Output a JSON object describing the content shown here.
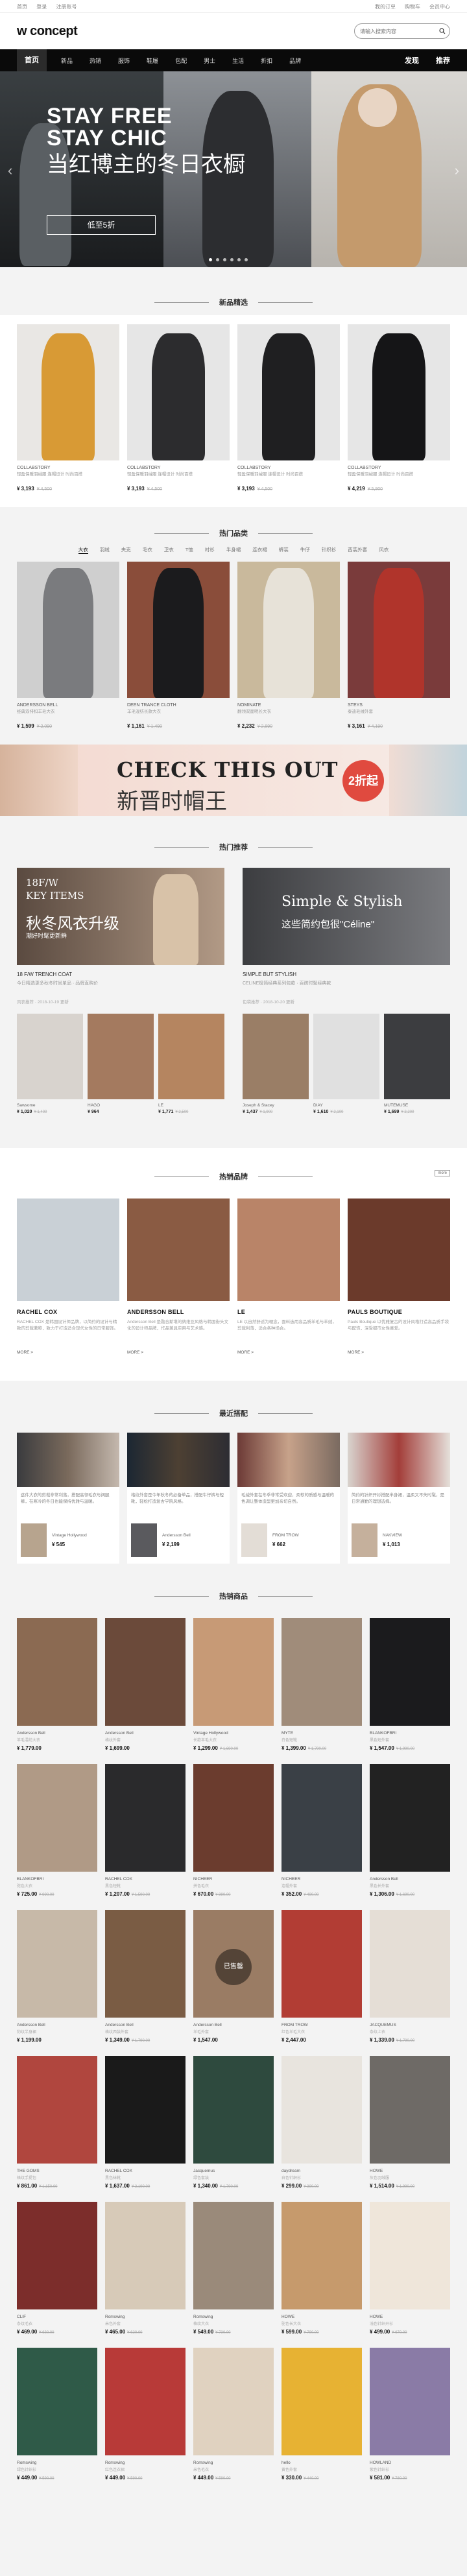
{
  "topbar": {
    "left": [
      "首页",
      "登录",
      "注册账号"
    ],
    "right": [
      "我的订单",
      "购物车",
      "会员中心"
    ]
  },
  "header": {
    "logo": "w concept",
    "search_placeholder": "请输入搜索内容"
  },
  "nav": {
    "items": [
      "首页",
      "新品",
      "热销",
      "服饰",
      "鞋履",
      "包配",
      "男士",
      "生活",
      "折扣",
      "品牌",
      "发现",
      "推荐"
    ]
  },
  "hero": {
    "headline1": "STAY FREE",
    "headline2": "STAY CHIC",
    "cn": "当红博主的冬日衣橱",
    "cta": "低至5折"
  },
  "sections": {
    "new": "新品精选",
    "hot_category": "热门品类",
    "hot_recommend": "热门推荐",
    "hot_brand": "热销品牌",
    "blog": "最近搭配",
    "hot_products": "热销商品"
  },
  "new_products": [
    {
      "brand": "COLLABSTORY",
      "desc": "轻盈保暖羽绒服 连帽设计 时尚百搭",
      "price": "¥ 3,193",
      "old": "¥ 4,500"
    },
    {
      "brand": "COLLABSTORY",
      "desc": "轻盈保暖羽绒服 连帽设计 时尚百搭",
      "price": "¥ 3,193",
      "old": "¥ 4,500"
    },
    {
      "brand": "COLLABSTORY",
      "desc": "轻盈保暖羽绒服 连帽设计 时尚百搭",
      "price": "¥ 3,193",
      "old": "¥ 4,500"
    },
    {
      "brand": "COLLABSTORY",
      "desc": "轻盈保暖羽绒服 连帽设计 时尚百搭",
      "price": "¥ 4,219",
      "old": "¥ 5,900"
    }
  ],
  "category_tabs": [
    "大衣",
    "羽绒",
    "夹克",
    "毛衣",
    "卫衣",
    "T恤",
    "衬衫",
    "半身裙",
    "连衣裙",
    "裤装",
    "牛仔",
    "针织衫",
    "西装外套",
    "风衣",
    "半裙"
  ],
  "category_products": [
    {
      "brand": "Andersson Bell",
      "desc": "经典双排扣羊毛大衣",
      "price": "¥ 1,599",
      "old": "¥ 2,090"
    },
    {
      "brand": "DEEN TRANCE CLOTH",
      "desc": "羊毛混纺长款大衣",
      "price": "¥ 1,161",
      "old": "¥ 1,490"
    },
    {
      "brand": "NOMINATE",
      "desc": "翻领双面呢长大衣",
      "price": "¥ 2,232",
      "old": "¥ 2,890"
    },
    {
      "brand": "STEYS",
      "desc": "泰迪毛绒外套",
      "price": "¥ 3,161",
      "old": "¥ 4,190"
    }
  ],
  "banner": {
    "title": "CHECK THIS OUT",
    "cn": "新晋时帽王",
    "badge": "2折起"
  },
  "recommend": [
    {
      "title": "18 F/W TRENCH COAT",
      "sub": "今日精选更多秋冬时尚单品 · 品牌直购价",
      "meta": "风衣推荐 · 2018-10-19 更新",
      "overlay1": "18F/W",
      "overlay2": "KEY ITEMS",
      "overlay3": "秋冬风衣升级",
      "overlay4": "潮好时髦更新鲜",
      "items": [
        {
          "name": "Sawsome",
          "price": "¥ 1,020",
          "old": "¥ 1,400"
        },
        {
          "name": "HAGO",
          "price": "¥ 964",
          "old": ""
        },
        {
          "name": "LE",
          "price": "¥ 1,771",
          "old": "¥ 2,500"
        }
      ]
    },
    {
      "title": "SIMPLE BUT STYLISH",
      "sub": "CELINE极简经典系列包款 · 百搭时髦经典款",
      "meta": "包袋推荐 · 2018-10-20 更新",
      "overlay1": "Simple & Stylish",
      "overlay2": "这些简约包很\"Céline\"",
      "overlay3": "",
      "overlay4": "",
      "items": [
        {
          "name": "Joseph & Stacey",
          "price": "¥ 1,437",
          "old": "¥ 1,900"
        },
        {
          "name": "DIAY",
          "price": "¥ 1,610",
          "old": "¥ 2,100"
        },
        {
          "name": "MUTEMUSE",
          "price": "¥ 1,699",
          "old": "¥ 2,200"
        }
      ]
    }
  ],
  "brand_more_label": "more",
  "brands": [
    {
      "name": "RACHEL COX",
      "desc": "RACHEL COX 是韩国设计师品牌，以简约的设计与精致的剪裁著称，致力于打造适合现代女性的日常服饰。",
      "more": "MORE >"
    },
    {
      "name": "ANDERSSON BELL",
      "desc": "Andersson Bell 是融合斯堪的纳维亚风格与韩国街头文化的设计师品牌，作品兼具实用与艺术感。",
      "more": "MORE >"
    },
    {
      "name": "LE",
      "desc": "LE 以自然舒适为理念，面料选用高品质羊毛与羊绒，剪裁利落，适合各种场合。",
      "more": "MORE >"
    },
    {
      "name": "PAULS BOUTIQUE",
      "desc": "Pauls Boutique 以优雅复古的设计风格打造高品质手袋与配饰，深受都市女性喜爱。",
      "more": "MORE >"
    }
  ],
  "blog": [
    {
      "text": "这件大衣的剪裁非常利落，搭配高领毛衣与阔腿裤，在寒冷的冬日也能保持优雅与温暖。",
      "brand": "Vintage Hollywood",
      "price": "¥ 545"
    },
    {
      "text": "格纹外套是今年秋冬的必备单品，搭配牛仔裤与短靴，轻松打造复古学院风格。",
      "brand": "Andersson Bell",
      "price": "¥ 2,199"
    },
    {
      "text": "毛绒外套在冬季非常受欢迎，柔软的质感与温暖的色调让整体造型更加亲切自然。",
      "brand": "FROM TROW",
      "price": "¥ 662"
    },
    {
      "text": "简约的针织开衫搭配半身裙，温柔又不失时髦，是日常通勤的理想选择。",
      "brand": "NAKVIEW",
      "price": "¥ 1,013"
    }
  ],
  "hot_products": [
    [
      {
        "name": "Andersson Bell",
        "desc": "羊毛混纺大衣",
        "price": "¥ 1,779.00",
        "old": ""
      },
      {
        "name": "Andersson Bell",
        "desc": "格纹外套",
        "price": "¥ 1,699.00",
        "old": ""
      },
      {
        "name": "Vintage Hollywood",
        "desc": "长款羊毛大衣",
        "price": "¥ 1,299.00",
        "old": "¥ 1,690.00"
      },
      {
        "name": "MYTE",
        "desc": "白色短靴",
        "price": "¥ 1,399.00",
        "old": "¥ 1,790.00"
      },
      {
        "name": "BLANKOFBRI",
        "desc": "黑色短外套",
        "price": "¥ 1,547.00",
        "old": "¥ 1,990.00"
      }
    ],
    [
      {
        "name": "BLANKOFBRI",
        "desc": "驼色大衣",
        "price": "¥ 725.00",
        "old": "¥ 990.00"
      },
      {
        "name": "RACHEL COX",
        "desc": "黑色短靴",
        "price": "¥ 1,207.00",
        "old": "¥ 1,590.00"
      },
      {
        "name": "NICHEER",
        "desc": "拼色毛衣",
        "price": "¥ 670.00",
        "old": "¥ 890.00"
      },
      {
        "name": "NICHEER",
        "desc": "连帽外套",
        "price": "¥ 352.00",
        "old": "¥ 490.00"
      },
      {
        "name": "Andersson Bell",
        "desc": "黑色长外套",
        "price": "¥ 1,306.00",
        "old": "¥ 1,690.00"
      }
    ],
    [
      {
        "name": "Andersson Bell",
        "desc": "豹纹半身裙",
        "price": "¥ 1,199.00",
        "old": ""
      },
      {
        "name": "Andersson Bell",
        "desc": "格纹西装外套",
        "price": "¥ 1,349.00",
        "old": "¥ 1,790.00"
      },
      {
        "name": "Andersson Bell",
        "desc": "羊毛外套",
        "price": "¥ 1,547.00",
        "old": ""
      },
      {
        "name": "FROM TROW",
        "desc": "红色羊毛大衣",
        "price": "¥ 2,447.00",
        "old": ""
      },
      {
        "name": "JACQUEMUS",
        "desc": "条纹上衣",
        "price": "¥ 1,339.00",
        "old": "¥ 1,790.00"
      }
    ],
    [
      {
        "name": "THE GOMS",
        "desc": "格纹手提包",
        "price": "¥ 861.00",
        "old": "¥ 1,150.00"
      },
      {
        "name": "RACHEL COX",
        "desc": "黑色袜靴",
        "price": "¥ 1,637.00",
        "old": "¥ 2,190.00"
      },
      {
        "name": "Jacquemus",
        "desc": "绿色套装",
        "price": "¥ 1,340.00",
        "old": "¥ 1,790.00"
      },
      {
        "name": "daydream",
        "desc": "白色针织衫",
        "price": "¥ 299.00",
        "old": "¥ 390.00"
      },
      {
        "name": "HOWE",
        "desc": "灰色羽绒服",
        "price": "¥ 1,514.00",
        "old": "¥ 1,990.00"
      }
    ],
    [
      {
        "name": "CLIF",
        "desc": "条纹毛衣",
        "price": "¥ 469.00",
        "old": "¥ 630.00"
      },
      {
        "name": "Romswing",
        "desc": "米色外套",
        "price": "¥ 465.00",
        "old": "¥ 620.00"
      },
      {
        "name": "Romswing",
        "desc": "格纹大衣",
        "price": "¥ 549.00",
        "old": "¥ 730.00"
      },
      {
        "name": "HOWE",
        "desc": "驼色长大衣",
        "price": "¥ 599.00",
        "old": "¥ 790.00"
      },
      {
        "name": "HOWE",
        "desc": "浅色针织开衫",
        "price": "¥ 499.00",
        "old": "¥ 670.00"
      }
    ],
    [
      {
        "name": "Romswing",
        "desc": "绿色针织衫",
        "price": "¥ 449.00",
        "old": "¥ 590.00"
      },
      {
        "name": "Romswing",
        "desc": "红色连衣裙",
        "price": "¥ 449.00",
        "old": "¥ 590.00"
      },
      {
        "name": "Romswing",
        "desc": "米色毛衣",
        "price": "¥ 449.00",
        "old": "¥ 590.00"
      },
      {
        "name": "hello",
        "desc": "黄色外套",
        "price": "¥ 330.00",
        "old": "¥ 440.00"
      },
      {
        "name": "HOWLAND",
        "desc": "紫色针织衫",
        "price": "¥ 581.00",
        "old": "¥ 780.00"
      }
    ]
  ],
  "sold_out_label": "已售罄"
}
